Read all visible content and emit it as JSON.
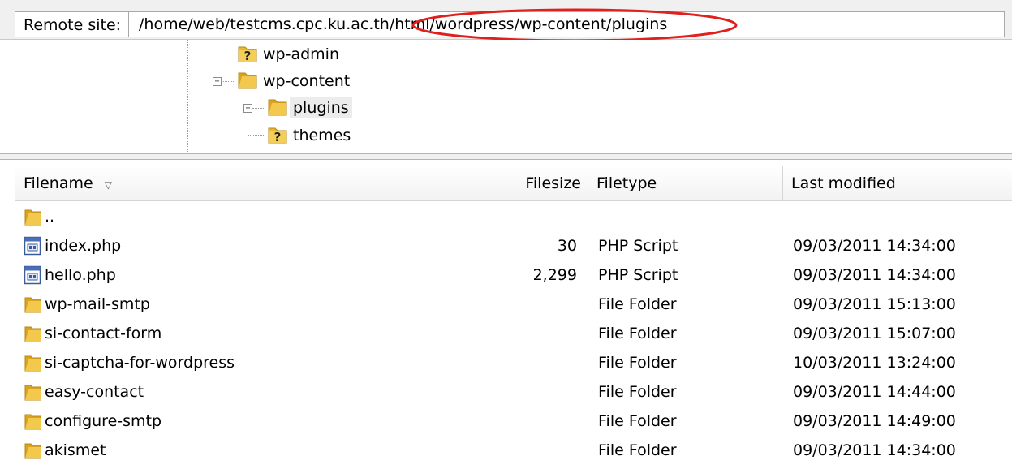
{
  "remote_site": {
    "label": "Remote site:",
    "path": "/home/web/testcms.cpc.ku.ac.th/html/wordpress/wp-content/plugins"
  },
  "tree": {
    "items": [
      {
        "label": "wp-admin",
        "icon": "unknown-folder-icon"
      },
      {
        "label": "wp-content",
        "icon": "folder-icon",
        "expander": "−"
      },
      {
        "label": "plugins",
        "icon": "folder-icon",
        "expander": "+",
        "selected": true
      },
      {
        "label": "themes",
        "icon": "unknown-folder-icon"
      }
    ]
  },
  "columns": {
    "filename": "Filename",
    "filesize": "Filesize",
    "filetype": "Filetype",
    "last_modified": "Last modified",
    "sort_indicator": "▽"
  },
  "files": [
    {
      "name": "..",
      "size": "",
      "type": "",
      "modified": "",
      "icon": "folder-icon"
    },
    {
      "name": "index.php",
      "size": "30",
      "type": "PHP Script",
      "modified": "09/03/2011 14:34:00",
      "icon": "php-file-icon"
    },
    {
      "name": "hello.php",
      "size": "2,299",
      "type": "PHP Script",
      "modified": "09/03/2011 14:34:00",
      "icon": "php-file-icon"
    },
    {
      "name": "wp-mail-smtp",
      "size": "",
      "type": "File Folder",
      "modified": "09/03/2011 15:13:00",
      "icon": "folder-icon"
    },
    {
      "name": "si-contact-form",
      "size": "",
      "type": "File Folder",
      "modified": "09/03/2011 15:07:00",
      "icon": "folder-icon"
    },
    {
      "name": "si-captcha-for-wordpress",
      "size": "",
      "type": "File Folder",
      "modified": "10/03/2011 13:24:00",
      "icon": "folder-icon"
    },
    {
      "name": "easy-contact",
      "size": "",
      "type": "File Folder",
      "modified": "09/03/2011 14:44:00",
      "icon": "folder-icon"
    },
    {
      "name": "configure-smtp",
      "size": "",
      "type": "File Folder",
      "modified": "09/03/2011 14:49:00",
      "icon": "folder-icon"
    },
    {
      "name": "akismet",
      "size": "",
      "type": "File Folder",
      "modified": "09/03/2011 14:34:00",
      "icon": "folder-icon"
    }
  ],
  "colors": {
    "annotation_ellipse": "#e0201e",
    "folder": "#e8b830"
  }
}
